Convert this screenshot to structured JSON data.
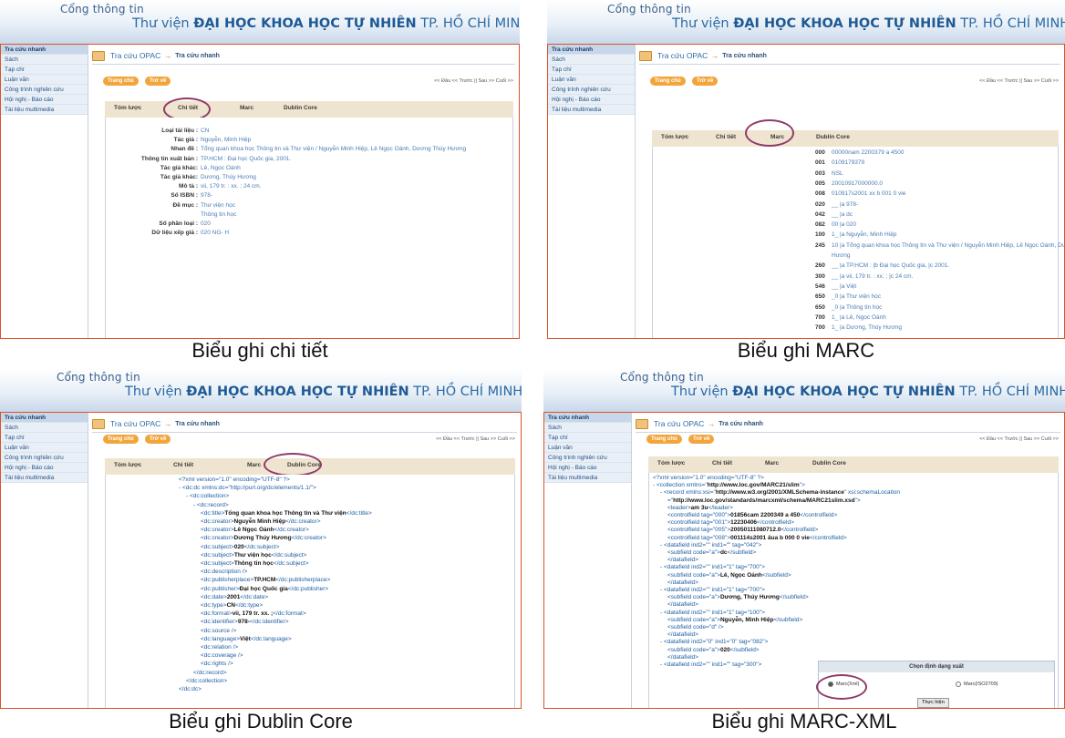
{
  "header": {
    "portal": "Cổng thông tin",
    "lib_prefix": "Thư viện",
    "lib_name": "ĐẠI HỌC KHOA HỌC TỰ NHIÊN",
    "lib_suffix": "TP. HỒ CHÍ MINH"
  },
  "sidebar": [
    "Tra cứu nhanh",
    "Sách",
    "Tạp chí",
    "Luận văn",
    "Công trình nghiên cứu",
    "Hội nghị - Báo cáo",
    "Tài liệu multimedia"
  ],
  "breadcrumb": {
    "root": "Tra cứu OPAC",
    "arrow": "→",
    "current": "Tra cứu nhanh"
  },
  "buttons": {
    "home": "Trang chủ",
    "back": "Trở về"
  },
  "pager": "<< Đầu << Trước || Sau >> Cuối >>",
  "tabs": [
    "Tóm lược",
    "Chi tiết",
    "Marc",
    "Dublin Core"
  ],
  "captions": [
    "Biểu ghi chi tiết",
    "Biểu ghi MARC",
    "Biểu ghi Dublin Core",
    "Biểu ghi MARC-XML"
  ],
  "detail": [
    {
      "k": "Loại tài liệu :",
      "v": "CN"
    },
    {
      "k": "Tác giả :",
      "v": "Nguyễn, Minh Hiệp"
    },
    {
      "k": "Nhan đề :",
      "v": "Tổng quan khoa học Thông tin và Thư viện / Nguyễn Minh Hiệp, Lê Ngọc Oánh, Dương Thúy Hương"
    },
    {
      "k": "Thông tin xuất bản :",
      "v": "TP.HCM : Đại học Quốc gia, 2001."
    },
    {
      "k": "Tác giả khác:",
      "v": "Lê, Ngọc Oánh"
    },
    {
      "k": "Tác giả khác:",
      "v": "Dương, Thúy Hương"
    },
    {
      "k": "Mô tả :",
      "v": "vii, 179 tr. : xx. ; 24 cm."
    },
    {
      "k": "Số ISBN :",
      "v": "978-"
    },
    {
      "k": "Đề mục :",
      "v": "Thư viện học"
    },
    {
      "k": "",
      "v": "Thông tin học"
    },
    {
      "k": "Số phân loại :",
      "v": "020"
    },
    {
      "k": "Dữ liệu xếp giá :",
      "v": "020 NG- H"
    }
  ],
  "marc": [
    {
      "t": "000",
      "v": "00000nam 2200379 a 4500"
    },
    {
      "t": "001",
      "v": "0109179379"
    },
    {
      "t": "003",
      "v": "NSL"
    },
    {
      "t": "005",
      "v": "20010917000000.0"
    },
    {
      "t": "008",
      "v": "010917s2001    xx     b    001 0 vie"
    },
    {
      "t": "020",
      "v": "__ |a 978-"
    },
    {
      "t": "042",
      "v": "__ |a dc"
    },
    {
      "t": "082",
      "v": "00 |a 020"
    },
    {
      "t": "100",
      "v": "1_ |a Nguyễn, Minh Hiệp"
    },
    {
      "t": "245",
      "v": "10 |a Tổng quan khoa học Thông tin và Thư viện / Nguyễn Minh Hiệp, Lê Ngọc Oánh, Dương Thúy"
    },
    {
      "t": "",
      "v": "Hương"
    },
    {
      "t": "260",
      "v": "__ |a TP.HCM : |b Đại học Quốc gia, |c 2001."
    },
    {
      "t": "300",
      "v": "__ |a vii, 179 tr. : xx. ; |c 24 cm."
    },
    {
      "t": "546",
      "v": "__ |a Việt"
    },
    {
      "t": "650",
      "v": "_0 |a Thư viện học"
    },
    {
      "t": "650",
      "v": "_0 |a Thông tin học"
    },
    {
      "t": "700",
      "v": "1_ |a Lê, Ngọc Oánh"
    },
    {
      "t": "700",
      "v": "1_ |a Dương, Thúy Hương"
    }
  ],
  "dc": [
    {
      "i": 0,
      "a": "<?xml version=\"1.0\" encoding=\"UTF-8\" ?>",
      "b": "",
      "c": ""
    },
    {
      "i": 0,
      "a": "- <dc:dc xmlns:dc=\"http://purl.org/dc/elements/1.1/\">",
      "b": "",
      "c": ""
    },
    {
      "i": 1,
      "a": "- <dc:collection>",
      "b": "",
      "c": ""
    },
    {
      "i": 2,
      "a": "- <dc:record>",
      "b": "",
      "c": ""
    },
    {
      "i": 3,
      "a": "<dc:title>",
      "b": "Tổng quan khoa học Thông tin và Thư viện",
      "c": "</dc:title>"
    },
    {
      "i": 3,
      "a": "<dc:creator>",
      "b": "Nguyễn Minh Hiệp",
      "c": "</dc:creator>"
    },
    {
      "i": 3,
      "a": "<dc:creator>",
      "b": "Lê Ngọc Oánh",
      "c": "</dc:creator>"
    },
    {
      "i": 3,
      "a": "<dc:creator>",
      "b": "Dương Thúy Hương",
      "c": "</dc:creator>"
    },
    {
      "i": 3,
      "a": "<dc:subject>",
      "b": "020",
      "c": "</dc:subject>"
    },
    {
      "i": 3,
      "a": "<dc:subject>",
      "b": "Thư viện học",
      "c": "</dc:subject>"
    },
    {
      "i": 3,
      "a": "<dc:subject>",
      "b": "Thông tin học",
      "c": "</dc:subject>"
    },
    {
      "i": 3,
      "a": "<dc:description />",
      "b": "",
      "c": ""
    },
    {
      "i": 3,
      "a": "<dc:publisherplace>",
      "b": "TP.HCM",
      "c": "</dc:publisherplace>"
    },
    {
      "i": 3,
      "a": "<dc:publisher>",
      "b": "Đại học Quốc gia",
      "c": "</dc:publisher>"
    },
    {
      "i": 3,
      "a": "<dc:date>",
      "b": "2001",
      "c": "</dc:date>"
    },
    {
      "i": 3,
      "a": "<dc:type>",
      "b": "CN",
      "c": "</dc:type>"
    },
    {
      "i": 3,
      "a": "<dc:format>",
      "b": "vii, 179 tr. xx. ;",
      "c": "</dc:format>"
    },
    {
      "i": 3,
      "a": "<dc:identifier>",
      "b": "978-",
      "c": "</dc:identifier>"
    },
    {
      "i": 3,
      "a": "<dc:source />",
      "b": "",
      "c": ""
    },
    {
      "i": 3,
      "a": "<dc:language>",
      "b": "Việt",
      "c": "</dc:language>"
    },
    {
      "i": 3,
      "a": "<dc:relation />",
      "b": "",
      "c": ""
    },
    {
      "i": 3,
      "a": "<dc:coverage />",
      "b": "",
      "c": ""
    },
    {
      "i": 3,
      "a": "<dc:rights />",
      "b": "",
      "c": ""
    },
    {
      "i": 2,
      "a": "</dc:record>",
      "b": "",
      "c": ""
    },
    {
      "i": 1,
      "a": "</dc:collection>",
      "b": "",
      "c": ""
    },
    {
      "i": 0,
      "a": "</dc:dc>",
      "b": "",
      "c": ""
    }
  ],
  "marcxml": [
    {
      "i": 0,
      "a": "<?xml version=\"1.0\" encoding=\"UTF-8\" ?>",
      "b": "",
      "c": ""
    },
    {
      "i": 0,
      "a": "- <collection xmlns=\"",
      "b": "http://www.loc.gov/MARC21/slim",
      "c": "\">"
    },
    {
      "i": 1,
      "a": "- <record xmlns:xsi=\"",
      "b": "http://www.w3.org/2001/XMLSchema-instance",
      "c": "\" xsi:schemaLocation"
    },
    {
      "i": 2,
      "a": "=\"",
      "b": "http://www.loc.gov/standards/marcxml/schema/MARC21slim.xsd",
      "c": "\">"
    },
    {
      "i": 2,
      "a": "<leader>",
      "b": "am 3u",
      "c": "</leader>"
    },
    {
      "i": 2,
      "a": "<controlfield tag=\"000\">",
      "b": "01856cam 2200349 a 450",
      "c": "</controlfield>"
    },
    {
      "i": 2,
      "a": "<controlfield tag=\"001\">",
      "b": "12230406",
      "c": "</controlfield>"
    },
    {
      "i": 2,
      "a": "<controlfield tag=\"005\">",
      "b": "20050111080712.0",
      "c": "</controlfield>"
    },
    {
      "i": 2,
      "a": "<controlfield tag=\"008\">",
      "b": "001114s2001 âua b 000 0 vie",
      "c": "</controlfield>"
    },
    {
      "i": 1,
      "a": "- <datafield ind2=\"\" ind1=\"\" tag=\"042\">",
      "b": "",
      "c": ""
    },
    {
      "i": 2,
      "a": "<subfield code=\"a\">",
      "b": "dc",
      "c": "</subfield>"
    },
    {
      "i": 2,
      "a": "</datafield>",
      "b": "",
      "c": ""
    },
    {
      "i": 1,
      "a": "- <datafield ind2=\"\" ind1=\"1\" tag=\"700\">",
      "b": "",
      "c": ""
    },
    {
      "i": 2,
      "a": "<subfield code=\"a\">",
      "b": "Lê, Ngọc Oánh",
      "c": "</subfield>"
    },
    {
      "i": 2,
      "a": "</datafield>",
      "b": "",
      "c": ""
    },
    {
      "i": 1,
      "a": "- <datafield ind2=\"\" ind1=\"1\" tag=\"700\">",
      "b": "",
      "c": ""
    },
    {
      "i": 2,
      "a": "<subfield code=\"a\">",
      "b": "Dương, Thúy Hương",
      "c": "</subfield>"
    },
    {
      "i": 2,
      "a": "</datafield>",
      "b": "",
      "c": ""
    },
    {
      "i": 1,
      "a": "- <datafield ind2=\"\" ind1=\"1\" tag=\"100\">",
      "b": "",
      "c": ""
    },
    {
      "i": 2,
      "a": "<subfield code=\"a\">",
      "b": "Nguyễn, Minh Hiệp",
      "c": "</subfield>"
    },
    {
      "i": 2,
      "a": "<subfield code=\"d\" />",
      "b": "",
      "c": ""
    },
    {
      "i": 2,
      "a": "</datafield>",
      "b": "",
      "c": ""
    },
    {
      "i": 1,
      "a": "- <datafield ind2=\"0\" ind1=\"0\" tag=\"082\">",
      "b": "",
      "c": ""
    },
    {
      "i": 2,
      "a": "<subfield code=\"a\">",
      "b": "020",
      "c": "</subfield>"
    },
    {
      "i": 2,
      "a": "</datafield>",
      "b": "",
      "c": ""
    },
    {
      "i": 1,
      "a": "- <datafield ind2=\"\" ind1=\"\" tag=\"300\">",
      "b": "",
      "c": ""
    }
  ],
  "popup": {
    "title": "Chọn định dạng xuất",
    "opt1": "Marc(Xml)",
    "opt2": "Marc(ISO2709)",
    "go": "Thực hiện"
  }
}
